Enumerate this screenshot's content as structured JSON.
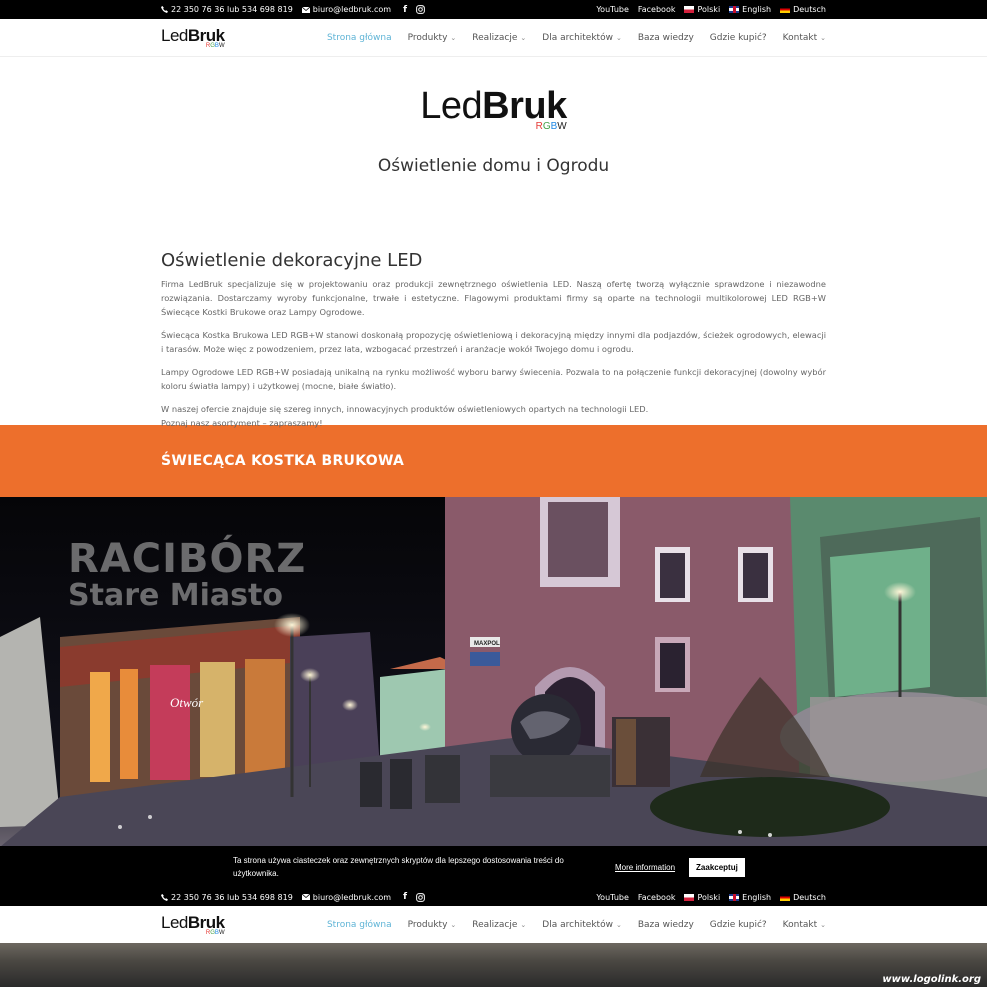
{
  "topbar": {
    "phone": "22 350 76 36 lub 534 698 819",
    "email": "biuro@ledbruk.com",
    "links": [
      "YouTube",
      "Facebook"
    ],
    "languages": [
      {
        "flag": "pl",
        "label": "Polski"
      },
      {
        "flag": "en",
        "label": "English"
      },
      {
        "flag": "de",
        "label": "Deutsch"
      }
    ]
  },
  "brand": {
    "word_light": "Led",
    "word_bold": "Bruk",
    "tag": "RGBW",
    "tag_colors": [
      "#e53935",
      "#43a047",
      "#1e88e5",
      "#222222"
    ]
  },
  "nav": {
    "items": [
      {
        "label": "Strona główna",
        "dropdown": false,
        "active": true
      },
      {
        "label": "Produkty",
        "dropdown": true,
        "active": false
      },
      {
        "label": "Realizacje",
        "dropdown": true,
        "active": false
      },
      {
        "label": "Dla architektów",
        "dropdown": true,
        "active": false
      },
      {
        "label": "Baza wiedzy",
        "dropdown": false,
        "active": false
      },
      {
        "label": "Gdzie kupić?",
        "dropdown": false,
        "active": false
      },
      {
        "label": "Kontakt",
        "dropdown": true,
        "active": false
      }
    ],
    "active_color": "#5fb4d6"
  },
  "hero": {
    "subtitle": "Oświetlenie domu i Ogrodu"
  },
  "content": {
    "heading": "Oświetlenie dekoracyjne LED",
    "paragraphs": [
      "Firma LedBruk specjalizuje się w projektowaniu oraz produkcji zewnętrznego oświetlenia LED. Naszą ofertę tworzą wyłącznie sprawdzone i niezawodne rozwiązania. Dostarczamy wyroby funkcjonalne, trwałe i estetyczne. Flagowymi produktami firmy są oparte na technologii multikolorowej LED RGB+W Świecące Kostki Brukowe oraz Lampy Ogrodowe.",
      "Świecąca Kostka Brukowa LED RGB+W stanowi doskonałą propozycję oświetleniową i dekoracyjną między innymi dla podjazdów, ścieżek ogrodowych, elewacji i tarasów. Może więc z powodzeniem, przez lata, wzbogacać przestrzeń i aranżacje wokół Twojego domu i ogrodu.",
      "Lampy Ogrodowe LED RGB+W posiadają unikalną na rynku możliwość wyboru barwy świecenia. Pozwala to na połączenie funkcji dekoracyjnej (dowolny wybór koloru światła lampy) i użytkowej (mocne, białe światło).",
      "W naszej ofercie znajduje się szereg innych, innowacyjnych  produktów oświetleniowych opartych na technologii LED.",
      "Poznaj nasz asortyment – zapraszamy!"
    ]
  },
  "section": {
    "title": "ŚWIECĄCA KOSTKA BRUKOWA",
    "bg_color": "#ed6f2c"
  },
  "photo": {
    "overlay_line1": "RACIBÓRZ",
    "overlay_line2": "Stare Miasto",
    "shop_sign": "Otwór",
    "store_sign": "MAXPOL"
  },
  "cookie": {
    "message": "Ta strona używa ciasteczek oraz zewnętrznych skryptów dla lepszego dostosowania treści do użytkownika.",
    "more_label": "More information",
    "accept_label": "Zaakceptuj"
  },
  "watermark": "www.logolink.org"
}
